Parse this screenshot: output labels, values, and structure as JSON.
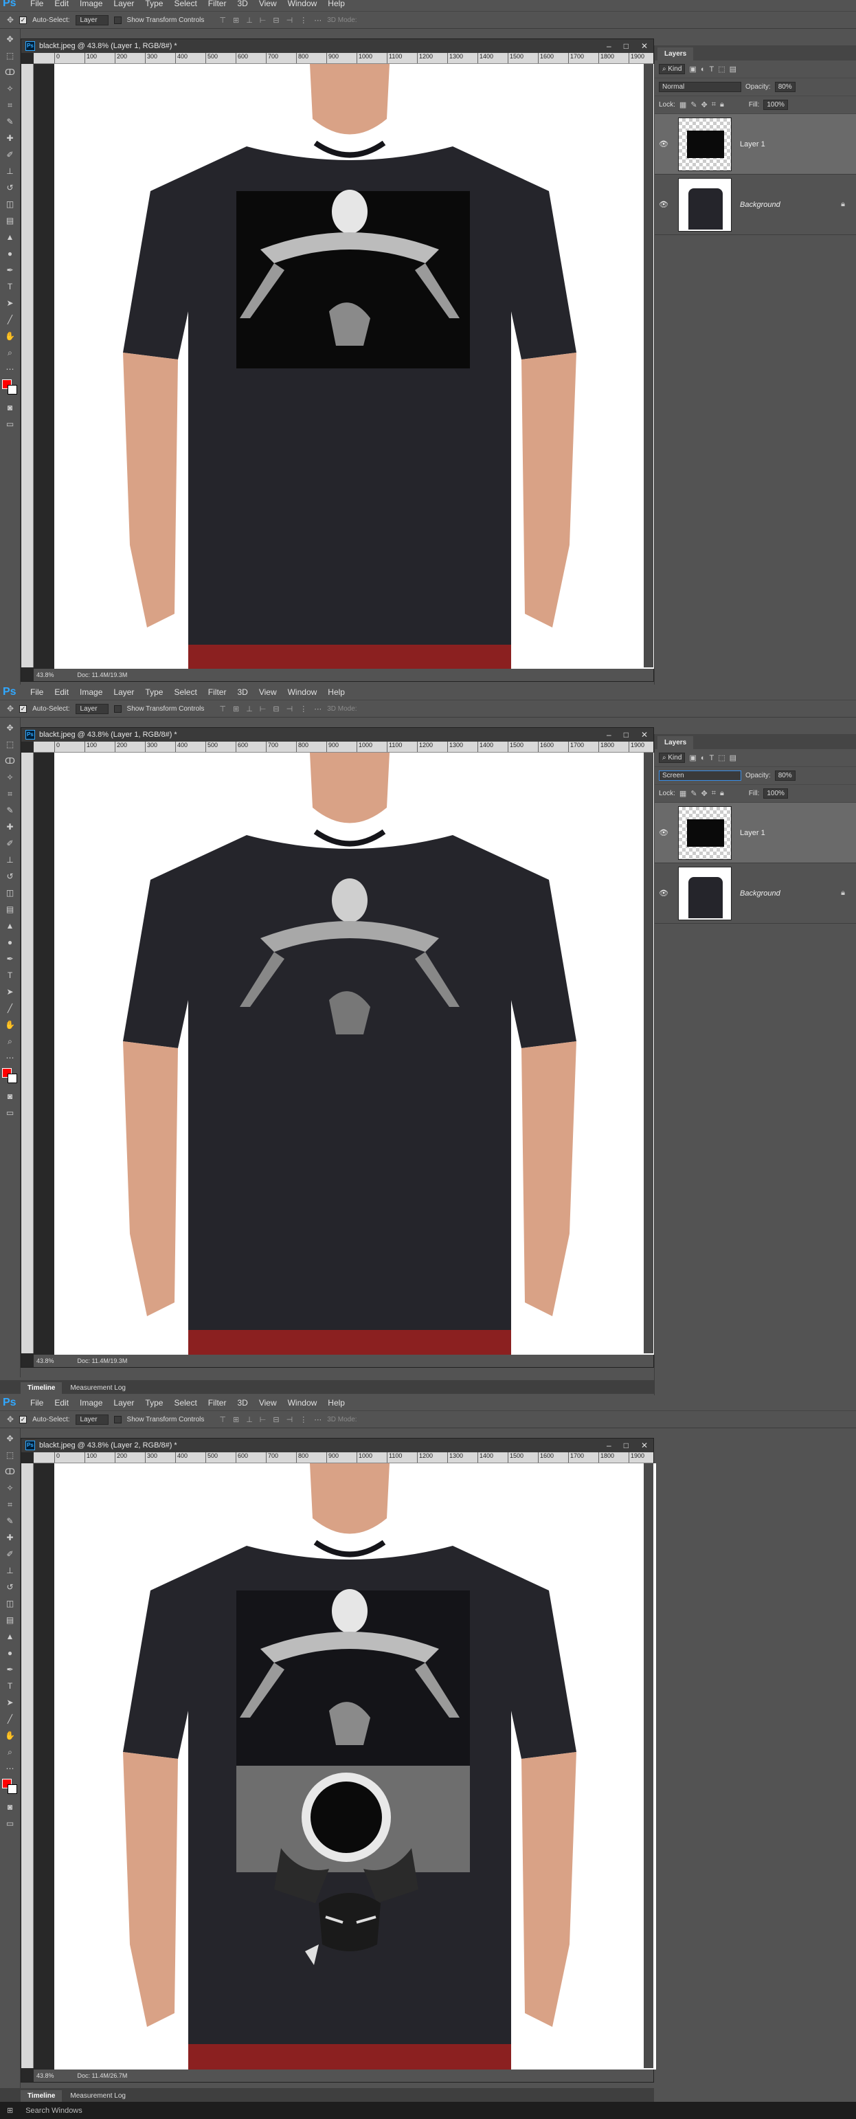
{
  "app": {
    "logo": "Ps",
    "menu": [
      "File",
      "Edit",
      "Image",
      "Layer",
      "Type",
      "Select",
      "Filter",
      "3D",
      "View",
      "Window",
      "Help"
    ]
  },
  "options_bar": {
    "auto_select_label": "Auto-Select:",
    "auto_select_value": "Layer",
    "transform_label": "Show Transform Controls",
    "mode_3d_label": "3D Mode:"
  },
  "ruler_ticks": [
    "0",
    "100",
    "200",
    "300",
    "400",
    "500",
    "600",
    "700",
    "800",
    "900",
    "1000",
    "1100",
    "1200",
    "1300",
    "1400",
    "1500",
    "1600",
    "1700",
    "1800",
    "1900"
  ],
  "screens": [
    {
      "doc_title": "blackt.jpeg @ 43.8% (Layer 1, RGB/8#) *",
      "zoom": "43.8%",
      "doc_size": "Doc: 11.4M/19.3M",
      "blend_mode": "Normal",
      "opacity_label": "Opacity:",
      "opacity_value": "80%",
      "lock_label": "Lock:",
      "fill_label": "Fill:",
      "fill_value": "100%",
      "kind_label": "Kind",
      "layers": [
        {
          "name": "Layer 1",
          "active": true
        },
        {
          "name": "Background",
          "active": false
        }
      ]
    },
    {
      "doc_title": "blackt.jpeg @ 43.8% (Layer 1, RGB/8#) *",
      "zoom": "43.8%",
      "doc_size": "Doc: 11.4M/19.3M",
      "blend_mode": "Screen",
      "opacity_label": "Opacity:",
      "opacity_value": "80%",
      "lock_label": "Lock:",
      "fill_label": "Fill:",
      "fill_value": "100%",
      "kind_label": "Kind",
      "layers": [
        {
          "name": "Layer 1",
          "active": true
        },
        {
          "name": "Background",
          "active": false
        }
      ]
    },
    {
      "doc_title": "blackt.jpeg @ 43.8% (Layer 2, RGB/8#) *",
      "zoom": "43.8%",
      "doc_size": "Doc: 11.4M/26.7M"
    }
  ],
  "panel_title": "Layers",
  "timeline_tabs": [
    "Timeline",
    "Measurement Log"
  ],
  "taskbar": {
    "search_text": "Search Windows"
  },
  "colors": {
    "foreground": "#ff0000",
    "background": "#ffffff",
    "ps_blue": "#31a8ff"
  }
}
